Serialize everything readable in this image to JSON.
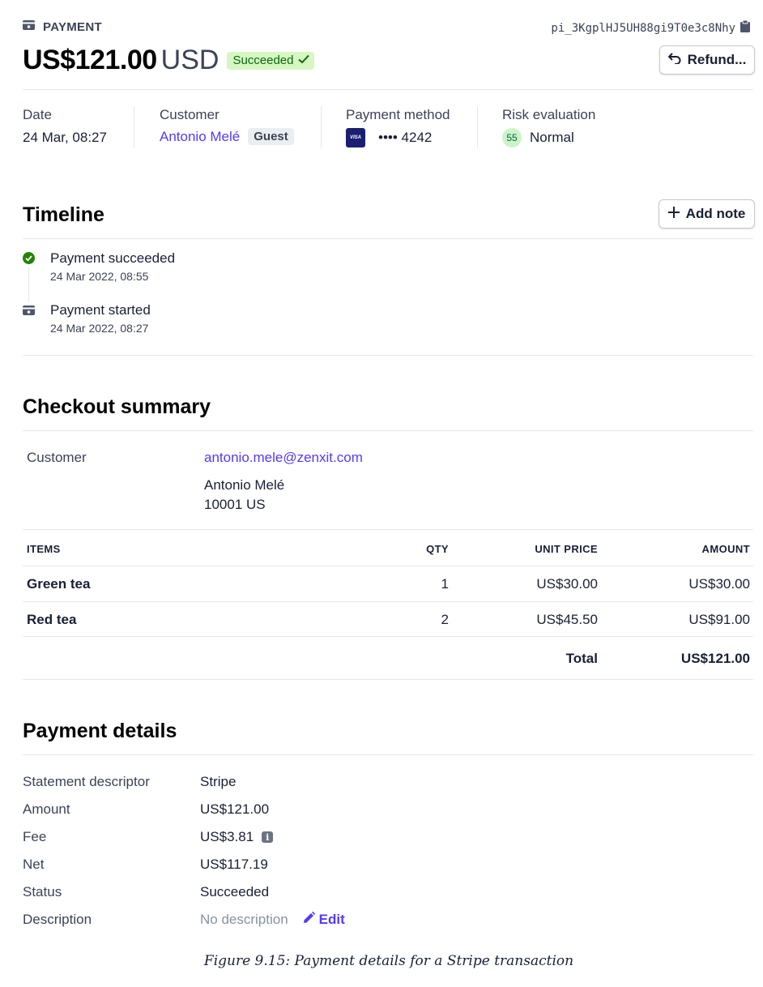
{
  "header": {
    "section_label": "PAYMENT",
    "payment_id": "pi_3KgplHJ5UH88gi9T0e3c8Nhy",
    "amount": "US$121.00",
    "currency": "USD",
    "status_badge": "Succeeded",
    "refund_label": "Refund..."
  },
  "summary": {
    "date_label": "Date",
    "date_value": "24 Mar, 08:27",
    "customer_label": "Customer",
    "customer_name": "Antonio Melé",
    "customer_badge": "Guest",
    "method_label": "Payment method",
    "card_brand": "VISA",
    "card_last4": "•••• 4242",
    "risk_label": "Risk evaluation",
    "risk_score": "55",
    "risk_value": "Normal"
  },
  "timeline": {
    "title": "Timeline",
    "add_note_label": "Add note",
    "events": [
      {
        "title": "Payment succeeded",
        "time": "24 Mar 2022, 08:55",
        "icon": "check-circle-icon"
      },
      {
        "title": "Payment started",
        "time": "24 Mar 2022, 08:27",
        "icon": "payment-icon"
      }
    ]
  },
  "checkout": {
    "title": "Checkout summary",
    "customer_label": "Customer",
    "email": "antonio.mele@zenxit.com",
    "name": "Antonio Melé",
    "address": "10001 US",
    "columns": [
      "ITEMS",
      "QTY",
      "UNIT PRICE",
      "AMOUNT"
    ],
    "rows": [
      {
        "item": "Green tea",
        "qty": "1",
        "unit_price": "US$30.00",
        "amount": "US$30.00"
      },
      {
        "item": "Red tea",
        "qty": "2",
        "unit_price": "US$45.50",
        "amount": "US$91.00"
      }
    ],
    "total_label": "Total",
    "total_value": "US$121.00"
  },
  "details": {
    "title": "Payment details",
    "rows": [
      {
        "label": "Statement descriptor",
        "value": "Stripe"
      },
      {
        "label": "Amount",
        "value": "US$121.00"
      },
      {
        "label": "Fee",
        "value": "US$3.81"
      },
      {
        "label": "Net",
        "value": "US$117.19"
      },
      {
        "label": "Status",
        "value": "Succeeded"
      },
      {
        "label": "Description",
        "value": "No description"
      }
    ],
    "edit_label": "Edit"
  },
  "caption": "Figure 9.15: Payment details for a Stripe transaction",
  "colors": {
    "accent": "#533afd",
    "success": "#228403",
    "badge_bg": "#d7f7c2",
    "risk_bg": "#cbf4c9"
  }
}
